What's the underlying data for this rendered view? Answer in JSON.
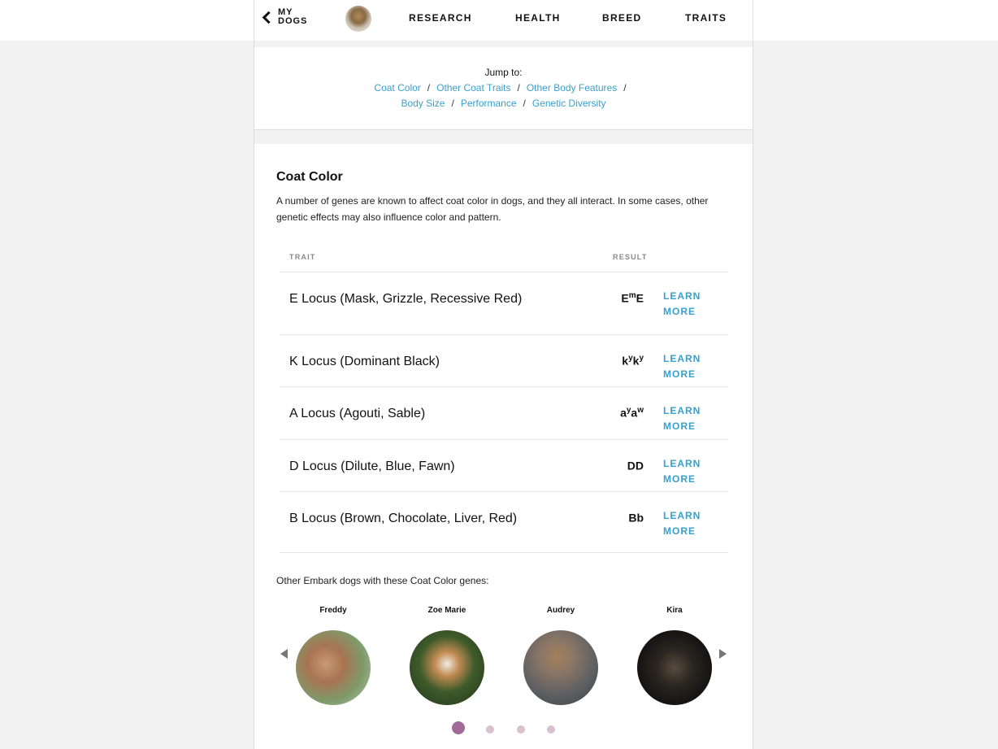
{
  "nav": {
    "back_label": "MY DOGS",
    "links": [
      "RESEARCH",
      "HEALTH",
      "BREED",
      "TRAITS"
    ]
  },
  "jump": {
    "title": "Jump to:",
    "links": [
      "Coat Color",
      "Other Coat Traits",
      "Other Body Features",
      "Body Size",
      "Performance",
      "Genetic Diversity"
    ],
    "separator": "/"
  },
  "coat_color": {
    "title": "Coat Color",
    "description": "A number of genes are known to affect coat color in dogs, and they all interact. In some cases, other genetic effects may also influence color and pattern.",
    "col_trait": "TRAIT",
    "col_result": "RESULT",
    "learn_more_label": "LEARN MORE",
    "rows": [
      {
        "trait": "E Locus (Mask, Grizzle, Recessive Red)",
        "result_base_1": "E",
        "result_sup_1": "m",
        "result_base_2": "E",
        "result_sup_2": ""
      },
      {
        "trait": "K Locus (Dominant Black)",
        "result_base_1": "k",
        "result_sup_1": "y",
        "result_base_2": "k",
        "result_sup_2": "y"
      },
      {
        "trait": "A Locus (Agouti, Sable)",
        "result_base_1": "a",
        "result_sup_1": "y",
        "result_base_2": "a",
        "result_sup_2": "w"
      },
      {
        "trait": "D Locus (Dilute, Blue, Fawn)",
        "result_base_1": "D",
        "result_sup_1": "",
        "result_base_2": "D",
        "result_sup_2": ""
      },
      {
        "trait": "B Locus (Brown, Chocolate, Liver, Red)",
        "result_base_1": "B",
        "result_sup_1": "",
        "result_base_2": "b",
        "result_sup_2": ""
      }
    ]
  },
  "others": {
    "label": "Other Embark dogs with these Coat Color genes:",
    "dogs": [
      "Freddy",
      "Zoe Marie",
      "Audrey",
      "Kira"
    ]
  },
  "colors": {
    "accent_link": "#3a9fcb",
    "dot_active": "#a06b98",
    "dot_inactive": "#d8c0d1"
  }
}
